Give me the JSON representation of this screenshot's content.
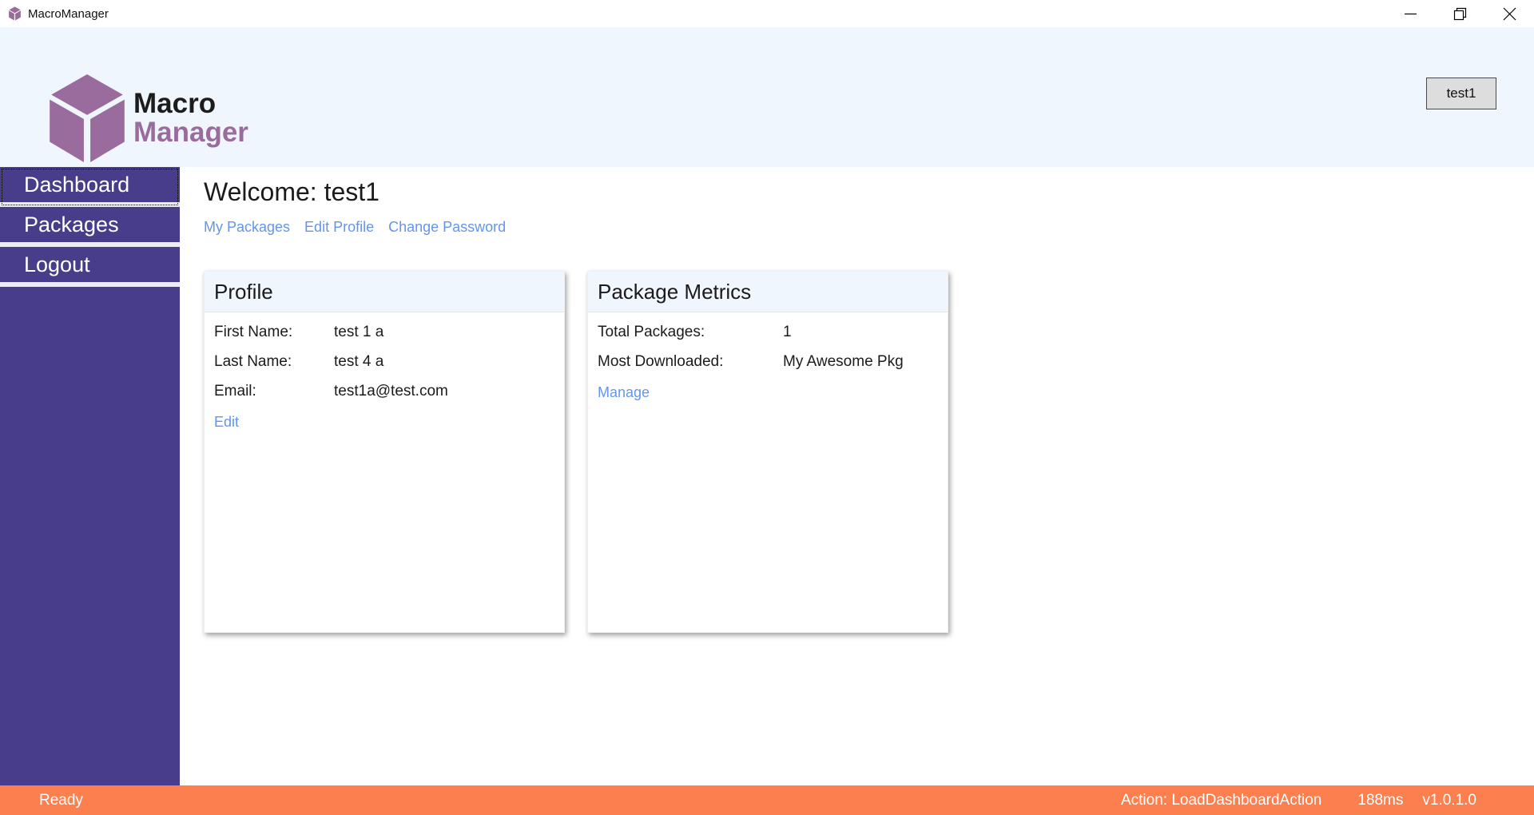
{
  "window": {
    "title": "MacroManager"
  },
  "header": {
    "logo_line1": "Macro",
    "logo_line2": "Manager",
    "user_button": "test1"
  },
  "sidebar": {
    "items": [
      {
        "label": "Dashboard",
        "active": true
      },
      {
        "label": "Packages",
        "active": false
      },
      {
        "label": "Logout",
        "active": false
      }
    ]
  },
  "main": {
    "welcome": "Welcome: test1",
    "links": [
      "My Packages",
      "Edit Profile",
      "Change Password"
    ],
    "cards": [
      {
        "title": "Profile",
        "rows": [
          {
            "label": "First Name:",
            "value": "test 1 a"
          },
          {
            "label": "Last Name:",
            "value": "test 4 a"
          },
          {
            "label": "Email:",
            "value": "test1a@test.com"
          }
        ],
        "link": "Edit"
      },
      {
        "title": "Package Metrics",
        "rows": [
          {
            "label": "Total Packages:",
            "value": "1"
          },
          {
            "label": "Most Downloaded:",
            "value": "My Awesome Pkg"
          }
        ],
        "link": "Manage"
      }
    ]
  },
  "statusbar": {
    "status": "Ready",
    "action": "Action: LoadDashboardAction",
    "duration": "188ms",
    "version": "v1.0.1.0"
  },
  "icons": {
    "app": "purple-cube-icon",
    "minimize": "minimize-icon",
    "restore": "restore-icon",
    "close": "close-icon"
  },
  "colors": {
    "sidebar": "#483D8B",
    "statusbar": "#FC7F50",
    "header_bg": "#EFF6FD",
    "link": "#6495ED",
    "logo_purple": "#9A6C9D"
  }
}
